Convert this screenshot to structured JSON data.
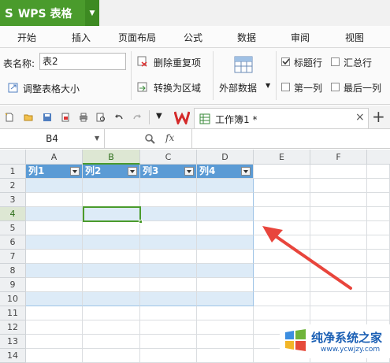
{
  "app": {
    "name": "WPS 表格"
  },
  "menu_tabs": [
    "开始",
    "插入",
    "页面布局",
    "公式",
    "数据",
    "审阅",
    "视图"
  ],
  "ribbon": {
    "table_name_label": "表名称:",
    "table_name_value": "表2",
    "resize_table": "调整表格大小",
    "remove_duplicates": "删除重复项",
    "convert_to_range": "转换为区域",
    "external_data": "外部数据",
    "options": [
      {
        "label": "标题行",
        "checked": true
      },
      {
        "label": "汇总行",
        "checked": false
      },
      {
        "label": "第一列",
        "checked": false
      },
      {
        "label": "最后一列",
        "checked": false
      }
    ]
  },
  "workbook_tab": {
    "title": "工作簿1 *"
  },
  "formula_bar": {
    "cell_ref": "B4",
    "fx": "fx"
  },
  "columns": [
    "A",
    "B",
    "C",
    "D",
    "E",
    "F"
  ],
  "rows": [
    "1",
    "2",
    "3",
    "4",
    "5",
    "6",
    "7",
    "8",
    "9",
    "10",
    "11",
    "12",
    "13",
    "14"
  ],
  "table_headers": [
    "列1",
    "列2",
    "列3",
    "列4"
  ],
  "selected_cell": "B4",
  "colors": {
    "accent_green": "#4a9b2c",
    "table_header": "#5b9bd5",
    "band": "#ddebf7",
    "arrow": "#e8453c"
  },
  "watermark": {
    "title": "纯净系统之家",
    "url": "www.ycwjzy.com"
  }
}
